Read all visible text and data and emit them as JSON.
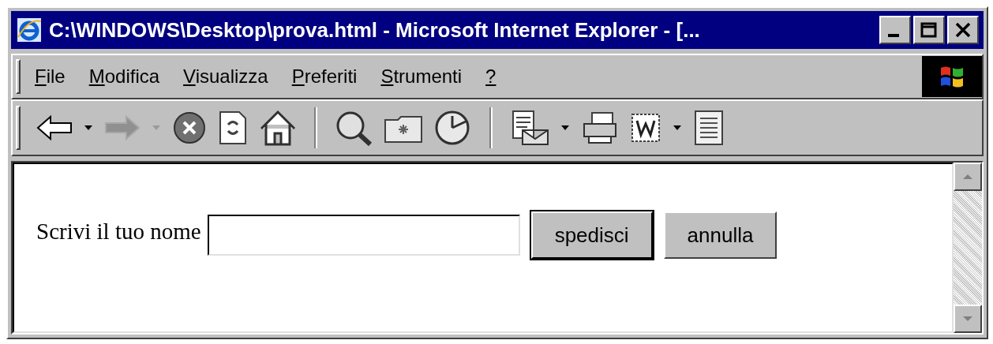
{
  "window": {
    "title": "C:\\WINDOWS\\Desktop\\prova.html - Microsoft Internet Explorer - [..."
  },
  "menu": [
    {
      "accel": "F",
      "rest": "ile"
    },
    {
      "accel": "M",
      "rest": "odifica"
    },
    {
      "accel": "V",
      "rest": "isualizza"
    },
    {
      "accel": "P",
      "rest": "referiti"
    },
    {
      "accel": "S",
      "rest": "trumenti"
    },
    {
      "accel": "?"
    }
  ],
  "toolbar": {
    "back": {
      "disabled": false
    },
    "forward": {
      "disabled": true
    }
  },
  "form": {
    "label": "Scrivi il tuo nome",
    "buttons": [
      {
        "label": "spedisci",
        "default": true
      },
      {
        "label": "annulla",
        "default": false
      }
    ]
  }
}
